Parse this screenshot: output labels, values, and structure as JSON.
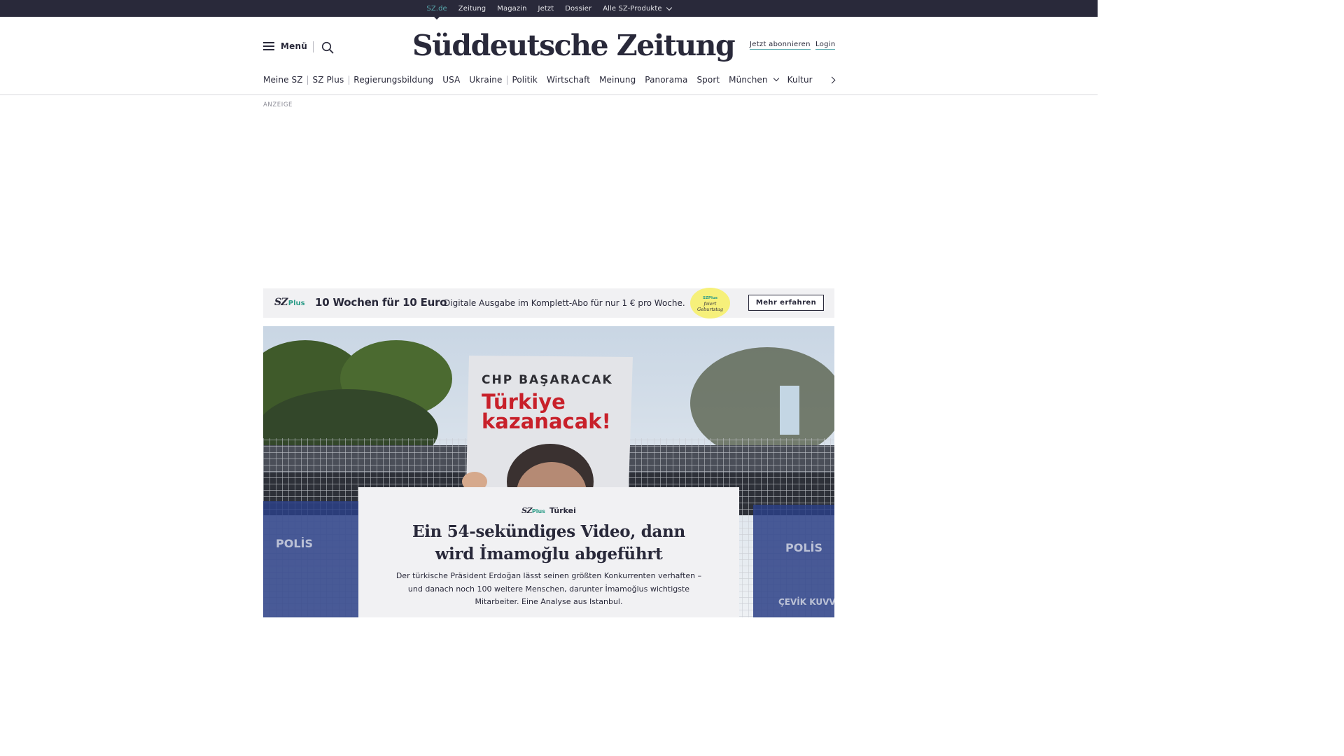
{
  "topbar": {
    "items": [
      "SZ.de",
      "Zeitung",
      "Magazin",
      "Jetzt",
      "Dossier",
      "Alle SZ-Produkte"
    ]
  },
  "header": {
    "menu_label": "Menü",
    "logo_text": "Süddeutsche Zeitung",
    "subscribe_label": "Jetzt abonnieren",
    "login_label": "Login"
  },
  "nav": {
    "items": [
      "Meine SZ",
      "SZ Plus",
      "Regierungsbildung",
      "USA",
      "Ukraine",
      "Politik",
      "Wirtschaft",
      "Meinung",
      "Panorama",
      "Sport",
      "München",
      "Kultur"
    ]
  },
  "ad": {
    "label": "ANZEIGE"
  },
  "promo": {
    "logo": "SZ",
    "logo_plus": "Plus",
    "title": "10 Wochen für 10 Euro",
    "text": "Digitale Ausgabe im Komplett-Abo für nur 1 € pro Woche.",
    "badge_logo": "SZ",
    "badge_plus": "Plus",
    "badge_line1": "feiert",
    "badge_line2": "Geburtstag",
    "button_label": "Mehr erfahren"
  },
  "hero": {
    "sign_line1": "CHP BAŞARACAK",
    "sign_line2": "Türkiye",
    "sign_line3": "kazanacak!",
    "barrier_text_left": "POLİS",
    "barrier_text_right": "POLİS",
    "barrier_text_bottom": "ÇEVİK KUVVET"
  },
  "teaser": {
    "sz": "SZ",
    "plus": "Plus",
    "topic": "Türkei",
    "title": "Ein 54-sekündiges Video, dann wird İmamoğlu abgeführt",
    "summary": "Der türkische Präsident Erdoğan lässt seinen größten Konkurrenten verhaften – und danach noch 100 weitere Menschen, darunter İmamoğlus wichtigste Mitarbeiter. Eine Analyse aus Istanbul."
  },
  "colors": {
    "topbar_bg": "#29293a",
    "accent": "#58a9ae",
    "plus_green": "#2c9c88",
    "promo_bg": "#f1f1f3",
    "badge_yellow": "#f6f07a",
    "sign_red": "#c8202a"
  }
}
